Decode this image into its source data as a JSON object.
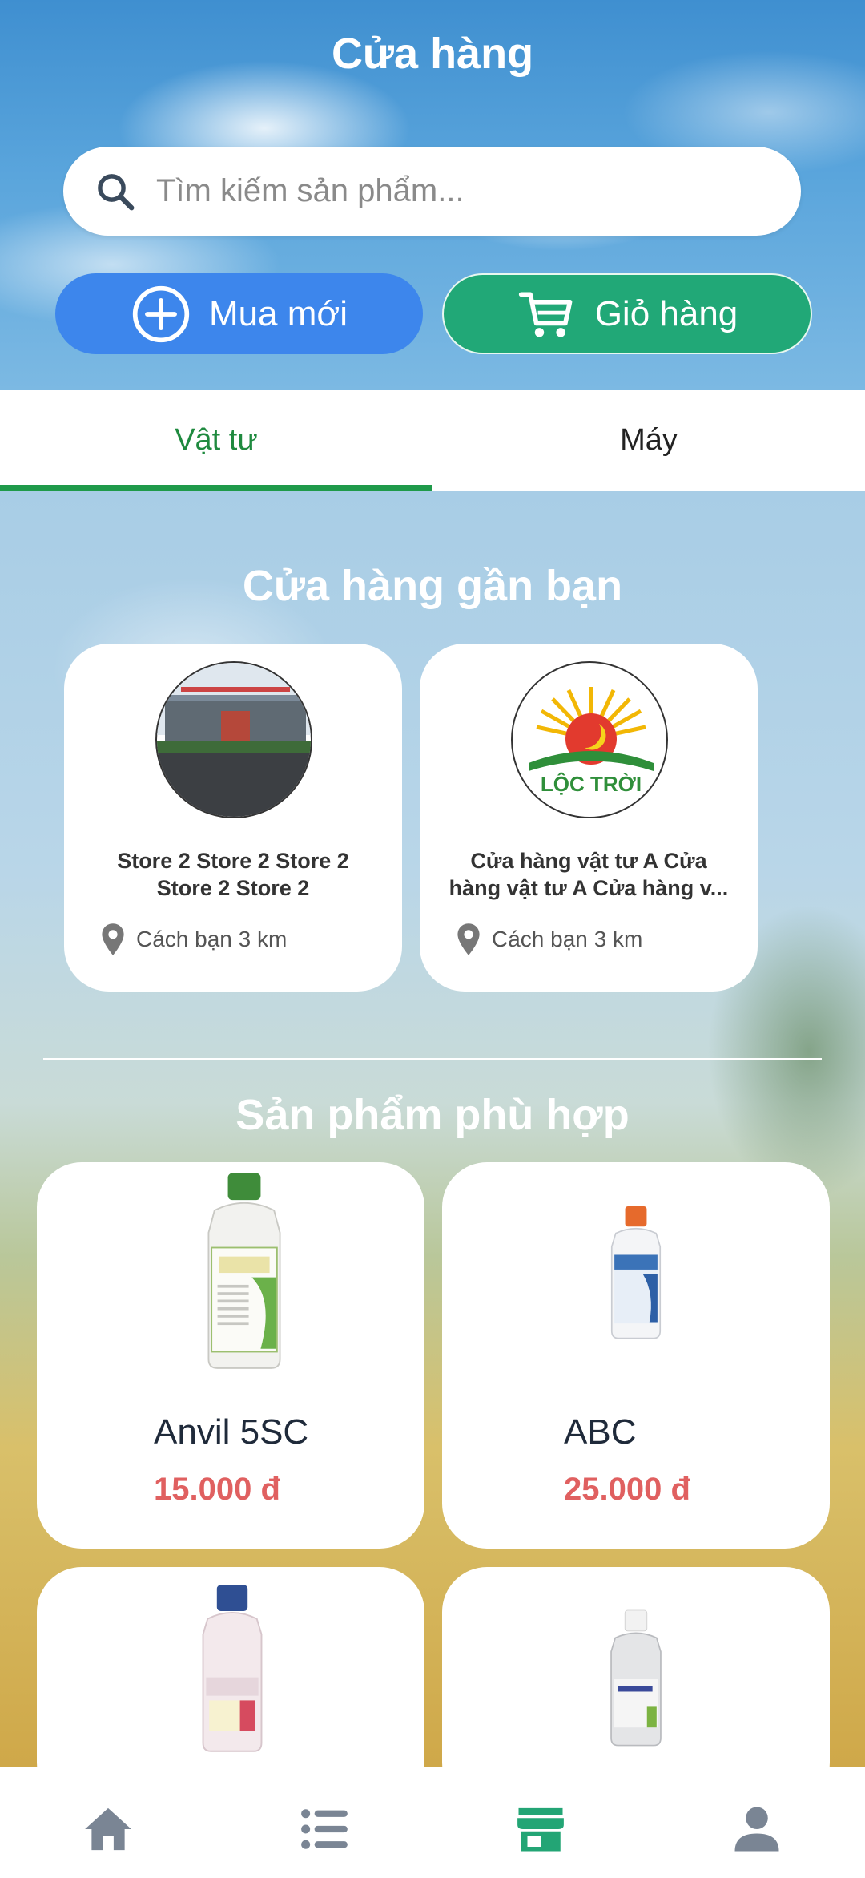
{
  "header": {
    "title": "Cửa hàng",
    "search_placeholder": "Tìm kiếm sản phẩm...",
    "buy_new_label": "Mua mới",
    "cart_label": "Giỏ hàng"
  },
  "tabs": [
    {
      "label": "Vật tư",
      "active": true
    },
    {
      "label": "Máy",
      "active": false
    }
  ],
  "nearby": {
    "title": "Cửa hàng gần bạn",
    "stores": [
      {
        "name": "Store 2 Store 2 Store 2 Store 2 Store 2",
        "distance": "Cách bạn 3 km"
      },
      {
        "name": "Cửa hàng vật tư A Cửa hàng vật tư A Cửa hàng v...",
        "distance": "Cách bạn 3 km",
        "logo_text": "LỘC TRỜI"
      }
    ]
  },
  "products": {
    "title": "Sản phẩm phù hợp",
    "items": [
      {
        "name": "Anvil 5SC",
        "price": "15.000 đ"
      },
      {
        "name": "ABC",
        "price": "25.000 đ"
      },
      {
        "name": "",
        "price": ""
      },
      {
        "name": "",
        "price": ""
      }
    ]
  },
  "bottom_nav": [
    {
      "icon": "home-icon"
    },
    {
      "icon": "list-icon"
    },
    {
      "icon": "store-icon",
      "active": true
    },
    {
      "icon": "user-icon"
    }
  ],
  "colors": {
    "primary_green": "#1f8a3f",
    "cart_green": "#21a877",
    "buy_blue": "#3d86ec",
    "price_red": "#e06060"
  }
}
